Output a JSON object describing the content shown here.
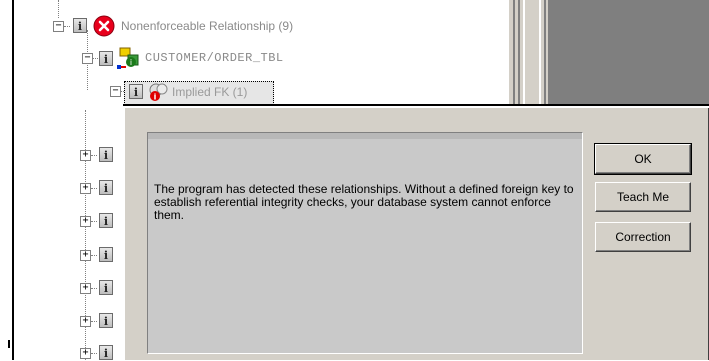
{
  "tree": {
    "root": {
      "label": "Nonenforceable Relationship (9)",
      "expander": "−"
    },
    "child": {
      "label": "CUSTOMER/ORDER_TBL",
      "expander": "−"
    },
    "grandchild": {
      "label": "Implied FK (1)",
      "expander": "−"
    },
    "collapsed_expander": "+"
  },
  "dialog": {
    "message": "The program has detected these relationships.  Without a defined foreign key to establish referential integrity checks, your database system cannot enforce them.",
    "buttons": {
      "ok": "OK",
      "teach_me": "Teach Me",
      "correction": "Correction"
    }
  },
  "colors": {
    "dialog_face": "#d4d0c8",
    "pane_gray": "#7f7f7f",
    "error_red": "#e8001c",
    "label_text": "#808080"
  }
}
